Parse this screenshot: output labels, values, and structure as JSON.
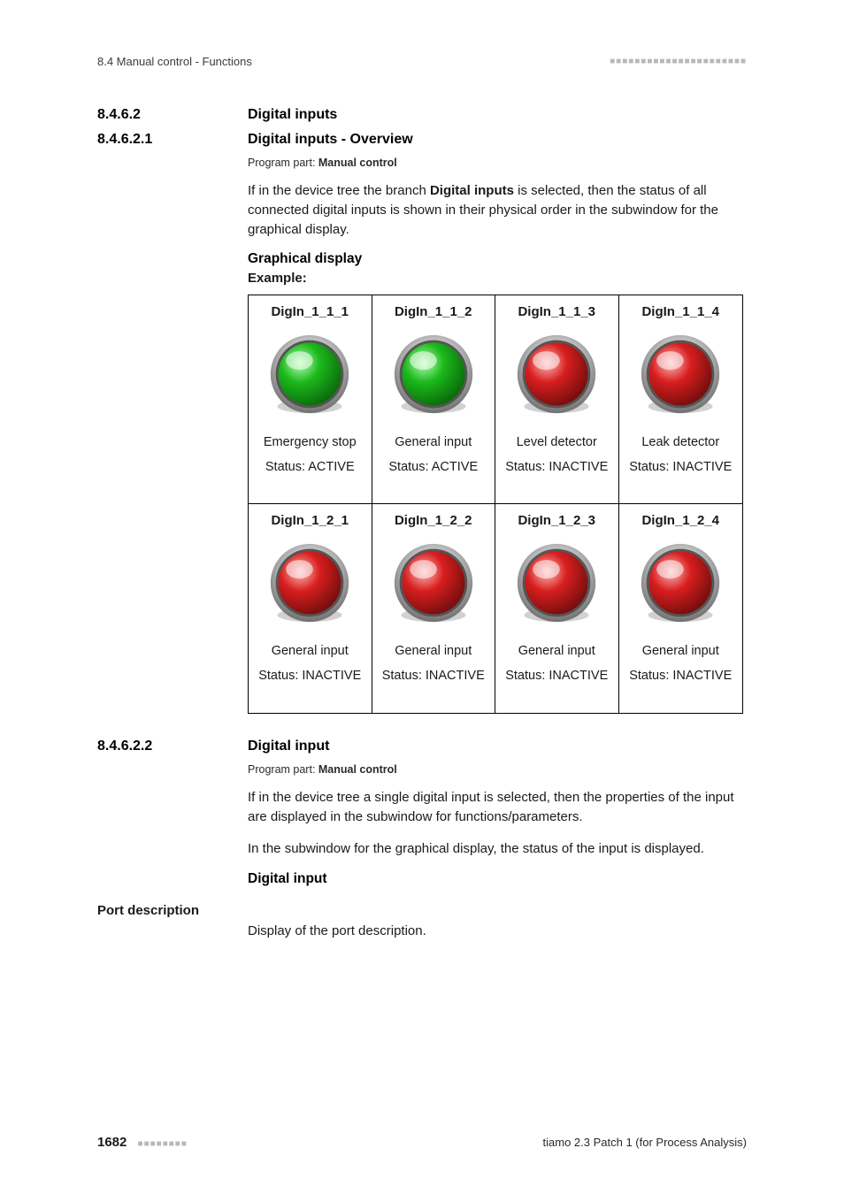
{
  "header": {
    "left": "8.4 Manual control - Functions",
    "dots": "■■■■■■■■■■■■■■■■■■■■■■"
  },
  "sec1": {
    "num": "8.4.6.2",
    "title": "Digital inputs"
  },
  "sec2": {
    "num": "8.4.6.2.1",
    "title": "Digital inputs - Overview"
  },
  "program_part_prefix": "Program part: ",
  "program_part_value": "Manual control",
  "overview_p1_a": "If in the device tree the branch ",
  "overview_p1_bold": "Digital inputs",
  "overview_p1_b": " is selected, then the status of all connected digital inputs is shown in their physical order in the sub­window for the graphical display.",
  "graphical_display_heading": "Graphical display",
  "example_label": "Example:",
  "inputs": [
    {
      "id": "DigIn_1_1_1",
      "label": "Emergency stop",
      "status": "Status: ACTIVE",
      "active": true
    },
    {
      "id": "DigIn_1_1_2",
      "label": "General input",
      "status": "Status: ACTIVE",
      "active": true
    },
    {
      "id": "DigIn_1_1_3",
      "label": "Level detector",
      "status": "Status: INAC­TIVE",
      "active": false
    },
    {
      "id": "DigIn_1_1_4",
      "label": "Leak detector",
      "status": "Status: INAC­TIVE",
      "active": false
    },
    {
      "id": "DigIn_1_2_1",
      "label": "General input",
      "status": "Status: INAC­TIVE",
      "active": false
    },
    {
      "id": "DigIn_1_2_2",
      "label": "General input",
      "status": "Status: INAC­TIVE",
      "active": false
    },
    {
      "id": "DigIn_1_2_3",
      "label": "General input",
      "status": "Status: INAC­TIVE",
      "active": false
    },
    {
      "id": "DigIn_1_2_4",
      "label": "General input",
      "status": "Status: INAC­TIVE",
      "active": false
    }
  ],
  "sec3": {
    "num": "8.4.6.2.2",
    "title": "Digital input"
  },
  "input_p1": "If in the device tree a single digital input is selected, then the properties of the input are displayed in the subwindow for functions/parameters.",
  "input_p2": "In the subwindow for the graphical display, the status of the input is dis­played.",
  "digital_input_heading": "Digital input",
  "port_desc_label": "Port description",
  "port_desc_body": "Display of the port description.",
  "footer": {
    "page": "1682",
    "dots": "■■■■■■■■",
    "right": "tiamo 2.3 Patch 1 (for Process Analysis)"
  },
  "colors": {
    "green": "#1bb91b",
    "red": "#d81e1e"
  }
}
